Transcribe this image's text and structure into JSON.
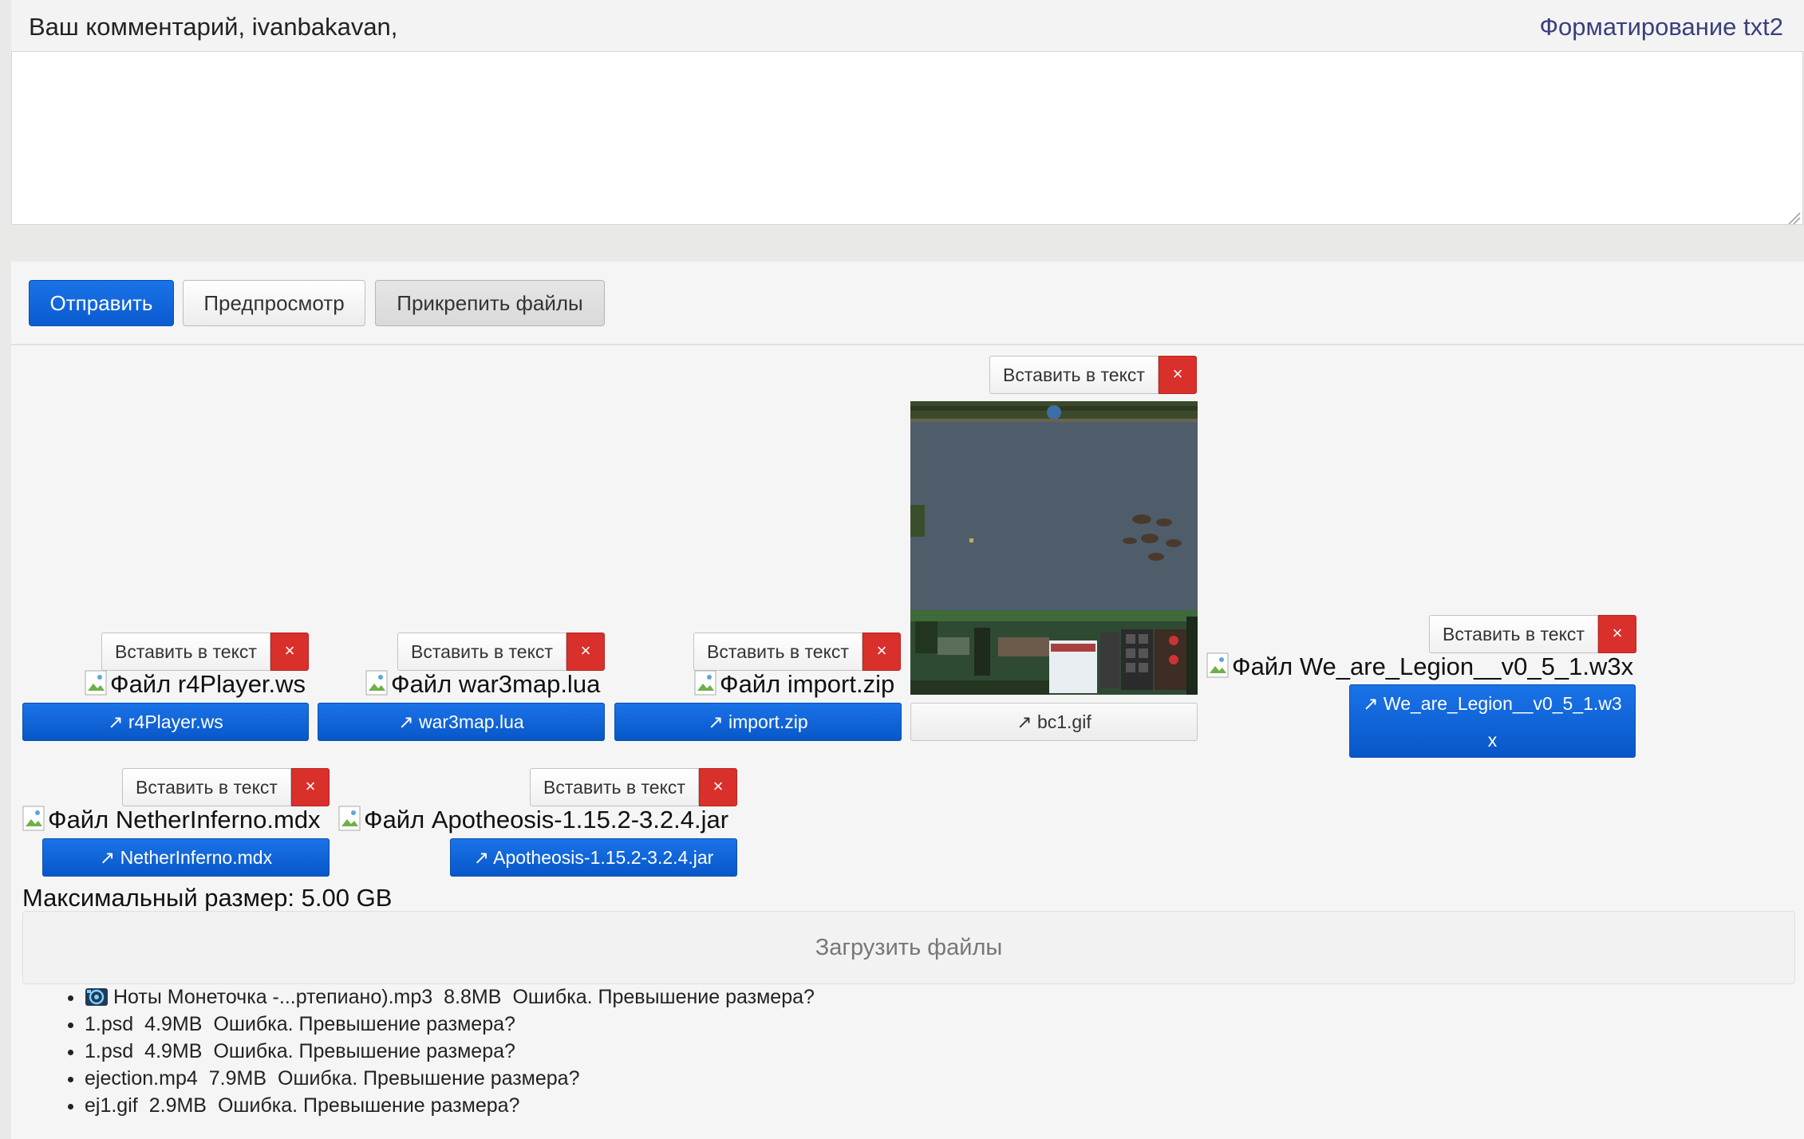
{
  "comment": {
    "label": "Ваш комментарий, ivanbakavan,",
    "format_link": "Форматирование txt2",
    "text": ""
  },
  "actions": {
    "submit": "Отправить",
    "preview": "Предпросмотр",
    "attach": "Прикрепить файлы"
  },
  "attachments": {
    "insert_label": "Вставить в текст",
    "close_glyph": "×",
    "items": [
      {
        "caption": "Файл r4Player.ws",
        "link": "↗ r4Player.ws"
      },
      {
        "caption": "Файл war3map.lua",
        "link": "↗ war3map.lua"
      },
      {
        "caption": "Файл import.zip",
        "link": "↗ import.zip"
      },
      {
        "caption": "",
        "link": "↗ bc1.gif"
      },
      {
        "caption": "Файл We_are_Legion__v0_5_1.w3x",
        "link_line1": "↗ We_are_Legion__v0_5_1.w3",
        "link_line2": "x"
      },
      {
        "caption": "Файл NetherInferno.mdx",
        "link": "↗ NetherInferno.mdx"
      },
      {
        "caption": "Файл Apotheosis-1.15.2-3.2.4.jar",
        "link": "↗ Apotheosis-1.15.2-3.2.4.jar"
      }
    ]
  },
  "upload": {
    "max_size": "Максимальный размер: 5.00 GB",
    "button": "Загрузить файлы",
    "errors": [
      {
        "name": "Ноты Монеточка -...ртепиано).mp3",
        "size": "8.8MB",
        "msg": "Ошибка. Превышение размера?"
      },
      {
        "name": "1.psd",
        "size": "4.9MB",
        "msg": "Ошибка. Превышение размера?"
      },
      {
        "name": "1.psd",
        "size": "4.9MB",
        "msg": "Ошибка. Превышение размера?"
      },
      {
        "name": "ejection.mp4",
        "size": "7.9MB",
        "msg": "Ошибка. Превышение размера?"
      },
      {
        "name": "ej1.gif",
        "size": "2.9MB",
        "msg": "Ошибка. Превышение размера?"
      }
    ]
  },
  "colors": {
    "primary": "#0a5bcf",
    "danger": "#d9302c",
    "link": "#3a3f7d"
  }
}
